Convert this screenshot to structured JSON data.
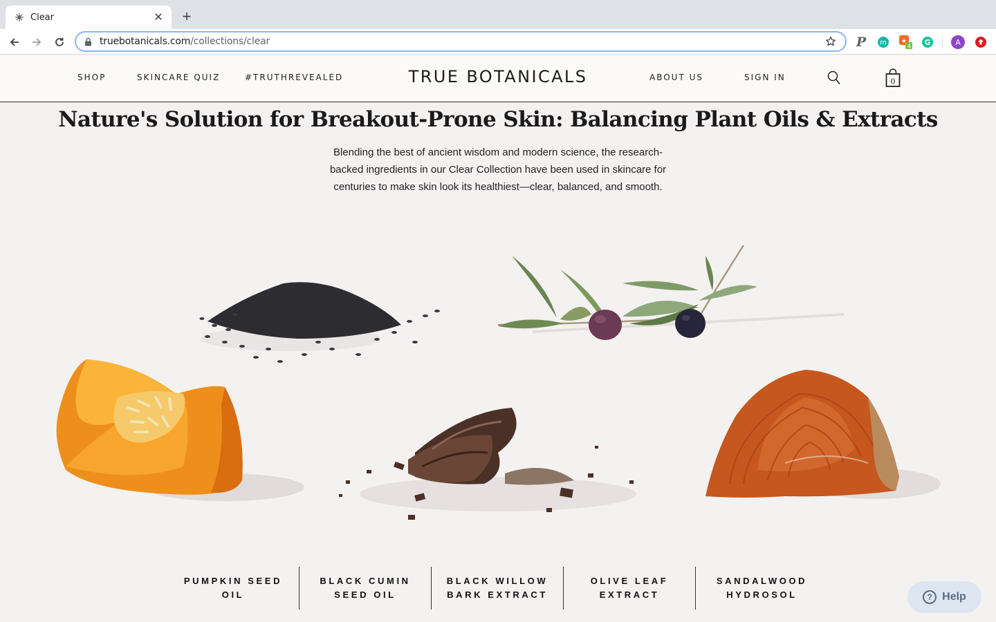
{
  "browser": {
    "tab_title": "Clear",
    "url_domain": "truebotanicals.com",
    "url_path": "/collections/clear",
    "extensions": [
      "pinterest-icon",
      "m-extension-icon",
      "tag-extension-icon",
      "grammarly-icon",
      "profile-avatar",
      "upload-icon"
    ],
    "avatar_letter": "A",
    "ext_badge": "4"
  },
  "header": {
    "nav_left": [
      "SHOP",
      "SKINCARE QUIZ",
      "#TRUTHREVEALED"
    ],
    "brand": "TRUE BOTANICALS",
    "nav_right": [
      "ABOUT US",
      "SIGN IN"
    ],
    "cart_count": "0"
  },
  "main": {
    "title": "Nature's Solution for Breakout-Prone Skin: Balancing Plant Oils & Extracts",
    "intro": "Blending the best of ancient wisdom and modern science, the research-backed ingredients in our Clear Collection have been used in skincare for centuries to make skin look its healthiest—clear, balanced, and smooth."
  },
  "ingredients": [
    {
      "line1": "PUMPKIN SEED",
      "line2": "OIL"
    },
    {
      "line1": "BLACK CUMIN",
      "line2": "SEED OIL"
    },
    {
      "line1": "BLACK WILLOW",
      "line2": "BARK EXTRACT"
    },
    {
      "line1": "OLIVE LEAF",
      "line2": "EXTRACT"
    },
    {
      "line1": "SANDALWOOD",
      "line2": "HYDROSOL"
    }
  ],
  "help": {
    "label": "Help"
  },
  "colors": {
    "page_bg": "#f4f1f1",
    "header_bg": "#fbfaf8",
    "help_bg": "#dde6f0",
    "help_fg": "#5a6c84"
  }
}
